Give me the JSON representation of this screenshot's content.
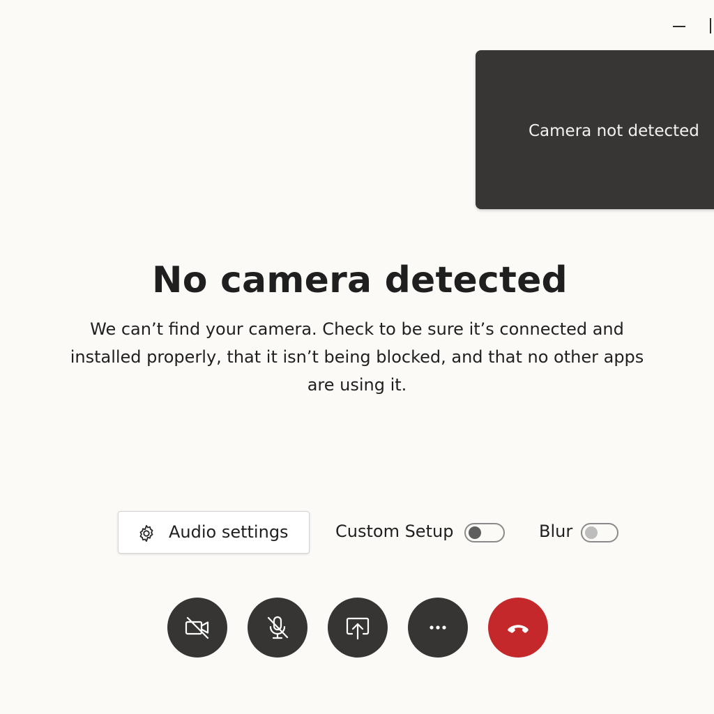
{
  "window": {
    "minimize_icon": "minimize-icon",
    "maximize_icon": "maximize-icon"
  },
  "self_view": {
    "label": "Camera not detected",
    "background": "#383634"
  },
  "main": {
    "title": "No camera detected",
    "message": "We can’t find your camera. Check to be sure it’s connected and installed properly, that it isn’t being blocked, and that no other apps are using it."
  },
  "settings": {
    "audio_settings_label": "Audio settings",
    "audio_settings_icon": "gear-icon",
    "custom_setup_label": "Custom Setup",
    "custom_setup_on": false,
    "blur_label": "Blur",
    "blur_on": false
  },
  "controls": [
    {
      "name": "camera-off-button",
      "icon": "camera-off-icon",
      "color": "#363533"
    },
    {
      "name": "mic-off-button",
      "icon": "mic-off-icon",
      "color": "#363533"
    },
    {
      "name": "share-screen-button",
      "icon": "share-icon",
      "color": "#363533"
    },
    {
      "name": "more-options-button",
      "icon": "more-icon",
      "color": "#363533"
    },
    {
      "name": "end-call-button",
      "icon": "hang-up-icon",
      "color": "#c4282b"
    }
  ]
}
